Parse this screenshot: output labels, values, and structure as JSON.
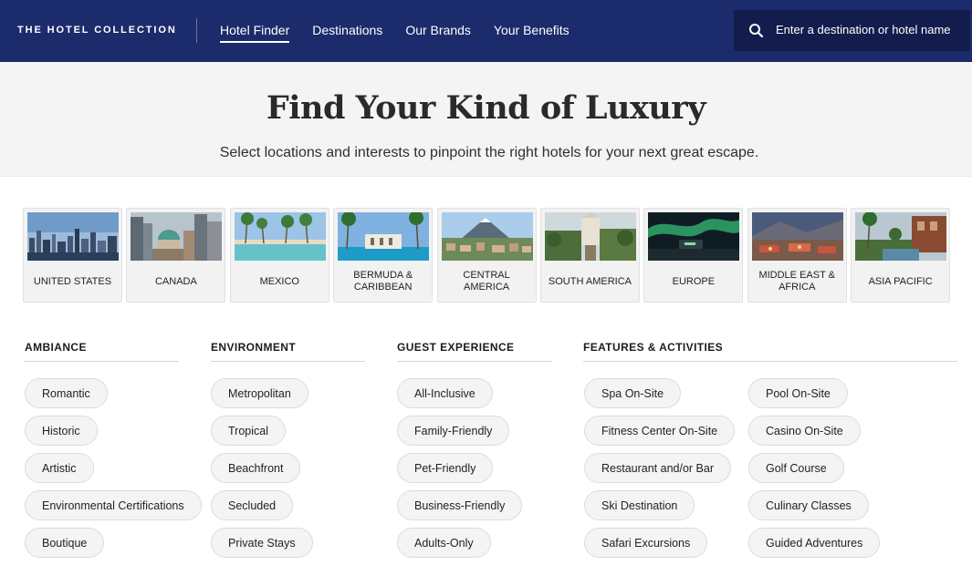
{
  "header": {
    "logo": "THE HOTEL COLLECTION",
    "nav": [
      {
        "label": "Hotel Finder",
        "active": true
      },
      {
        "label": "Destinations",
        "active": false
      },
      {
        "label": "Our Brands",
        "active": false
      },
      {
        "label": "Your Benefits",
        "active": false
      }
    ],
    "search": {
      "icon": "search-icon",
      "placeholder": "Enter a destination or hotel name"
    }
  },
  "hero": {
    "title": "Find Your Kind of Luxury",
    "subtitle": "Select locations and interests to pinpoint the right hotels for your next great escape."
  },
  "destinations": [
    {
      "label": "UNITED STATES"
    },
    {
      "label": "CANADA"
    },
    {
      "label": "MEXICO"
    },
    {
      "label": "BERMUDA & CARIBBEAN"
    },
    {
      "label": "CENTRAL AMERICA"
    },
    {
      "label": "SOUTH AMERICA"
    },
    {
      "label": "EUROPE"
    },
    {
      "label": "MIDDLE EAST & AFRICA"
    },
    {
      "label": "ASIA PACIFIC"
    }
  ],
  "filters": {
    "ambiance": {
      "heading": "AMBIANCE",
      "items": [
        "Romantic",
        "Historic",
        "Artistic",
        "Environmental Certifications",
        "Boutique"
      ]
    },
    "environment": {
      "heading": "ENVIRONMENT",
      "items": [
        "Metropolitan",
        "Tropical",
        "Beachfront",
        "Secluded",
        "Private Stays"
      ]
    },
    "guest_experience": {
      "heading": "GUEST EXPERIENCE",
      "items": [
        "All-Inclusive",
        "Family-Friendly",
        "Pet-Friendly",
        "Business-Friendly",
        "Adults-Only"
      ]
    },
    "features": {
      "heading": "FEATURES & ACTIVITIES",
      "items_left": [
        "Spa On-Site",
        "Fitness Center On-Site",
        "Restaurant and/or Bar",
        "Ski Destination",
        "Safari Excursions"
      ],
      "items_right": [
        "Pool On-Site",
        "Casino On-Site",
        "Golf Course",
        "Culinary Classes",
        "Guided Adventures"
      ]
    }
  },
  "colors": {
    "header_bg": "#1c2b6b",
    "search_bg": "#121d4e",
    "hero_bg": "#f4f4f4",
    "pill_bg": "#f4f4f4"
  }
}
